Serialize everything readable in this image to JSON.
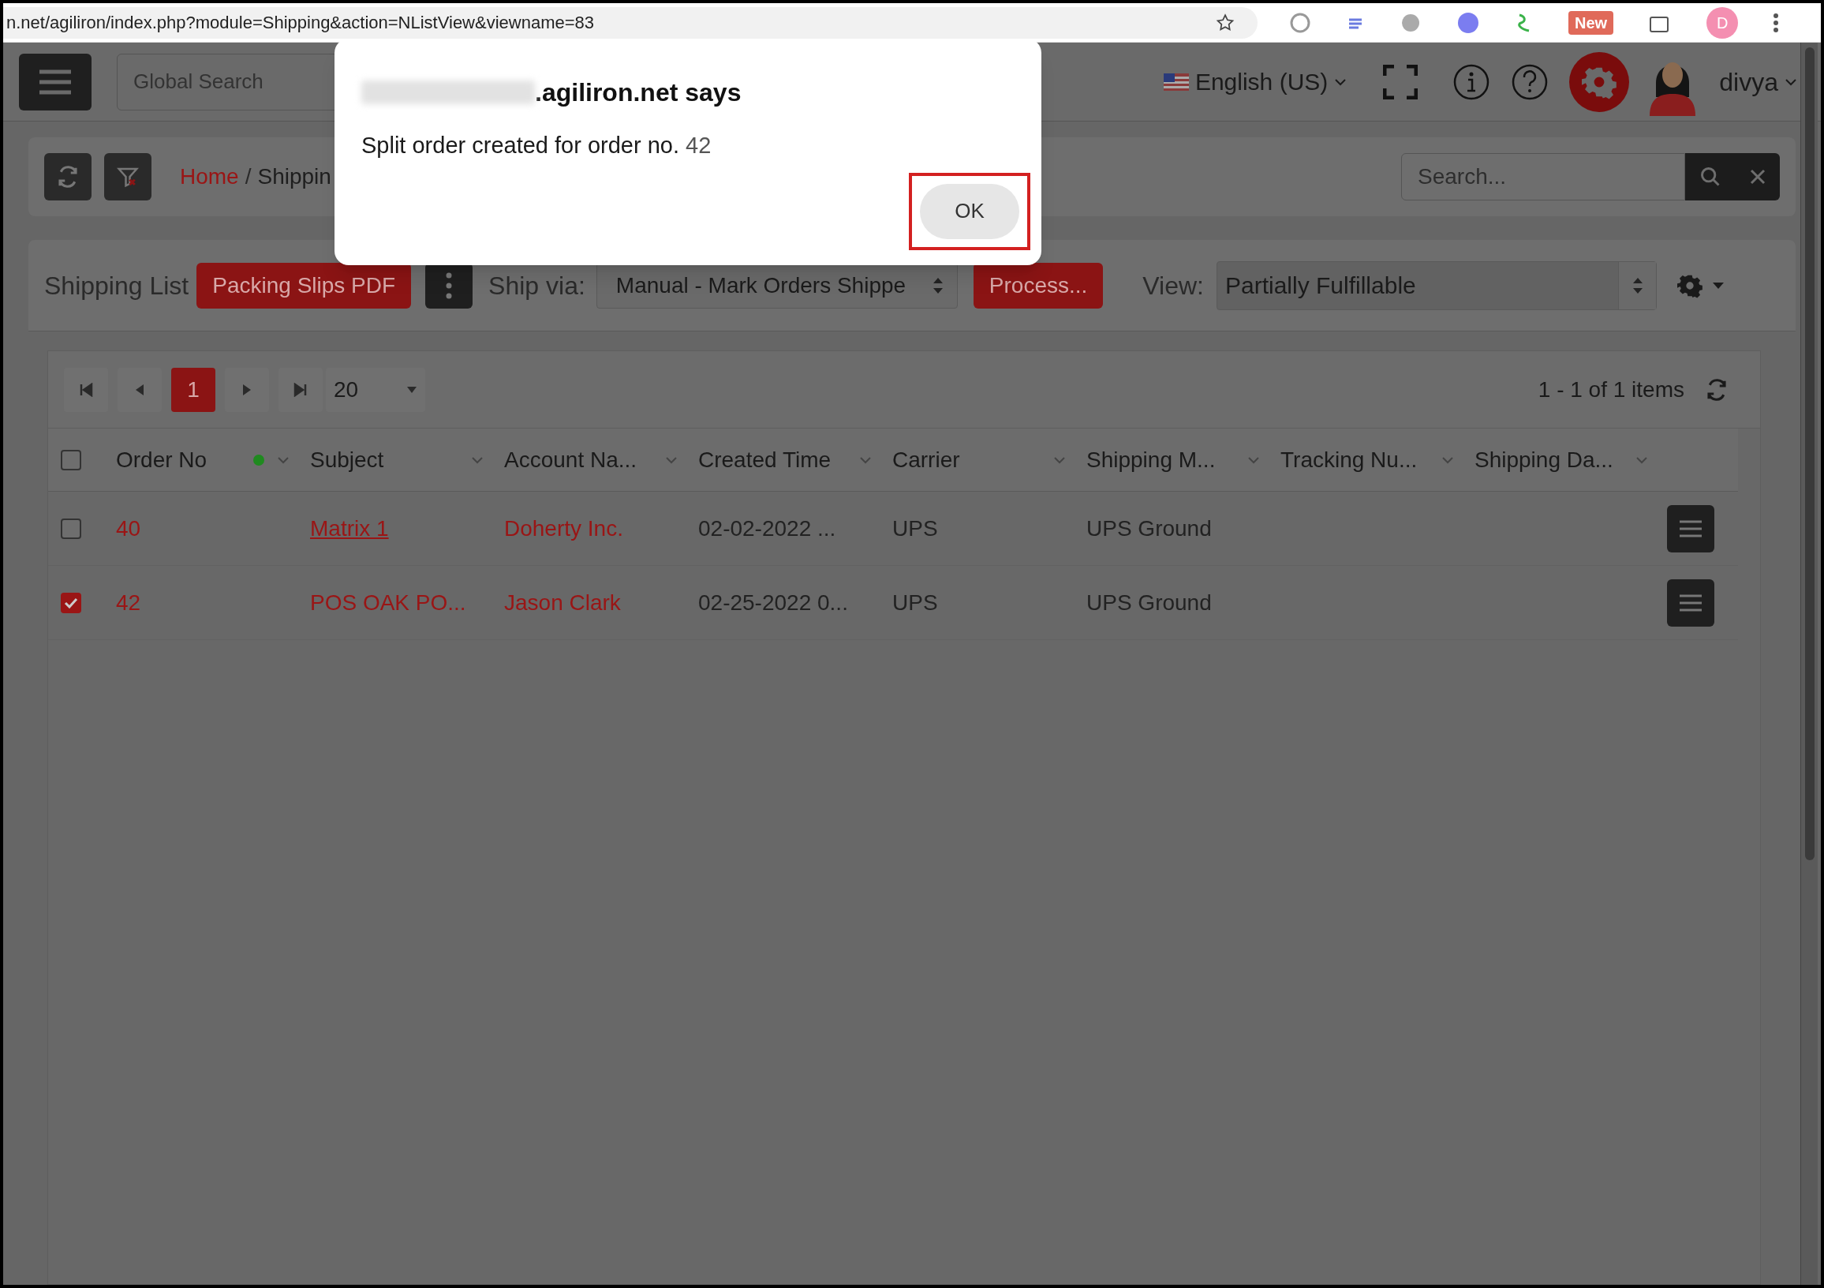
{
  "browser": {
    "url": "n.net/agiliron/index.php?module=Shipping&action=NListView&viewname=83",
    "new_badge": "New",
    "profile_initial": "D"
  },
  "header": {
    "global_search": {
      "placeholder": "Global Search"
    },
    "language": "English (US)",
    "user": "divya"
  },
  "toolbar": {
    "breadcrumb_separator": "/",
    "breadcrumb": [
      {
        "label": "Home",
        "kind": "link"
      },
      {
        "label": "Shippin",
        "kind": "current"
      }
    ],
    "search": {
      "placeholder": "Search..."
    }
  },
  "list_bar": {
    "title": "Shipping List",
    "packing_button": "Packing Slips PDF",
    "ship_via_label": "Ship via:",
    "ship_via_value": "Manual - Mark Orders Shippe",
    "process_button": "Process...",
    "view_label": "View:",
    "view_value": "Partially Fulfillable"
  },
  "pager": {
    "pages": [
      {
        "label": "1",
        "selected": true
      }
    ],
    "page_size": "20",
    "summary": "1 - 1 of 1 items"
  },
  "table": {
    "columns": [
      {
        "label": "Order No",
        "status_dot": true
      },
      {
        "label": "Subject",
        "status_dot": false
      },
      {
        "label": "Account Na...",
        "status_dot": false
      },
      {
        "label": "Created Time",
        "status_dot": false
      },
      {
        "label": "Carrier",
        "status_dot": false
      },
      {
        "label": "Shipping M...",
        "status_dot": false
      },
      {
        "label": "Tracking Nu...",
        "status_dot": false
      },
      {
        "label": "Shipping Da...",
        "status_dot": false
      }
    ],
    "all_checked": false,
    "rows": [
      {
        "checked": false,
        "order_no": "40",
        "subject": "Matrix 1",
        "subject_underlined": true,
        "account": "Doherty Inc.",
        "created": "02-02-2022 ...",
        "carrier": "UPS",
        "shipping_method": "UPS Ground"
      },
      {
        "checked": true,
        "order_no": "42",
        "subject": "POS OAK PO...",
        "subject_underlined": false,
        "account": "Jason Clark",
        "created": "02-25-2022 0...",
        "carrier": "UPS",
        "shipping_method": "UPS Ground"
      }
    ]
  },
  "dialog": {
    "title_suffix": ".agiliron.net says",
    "message": "Split order created for order no.",
    "order_no": "42",
    "ok_button": "OK",
    "ok_highlighted": true
  }
}
